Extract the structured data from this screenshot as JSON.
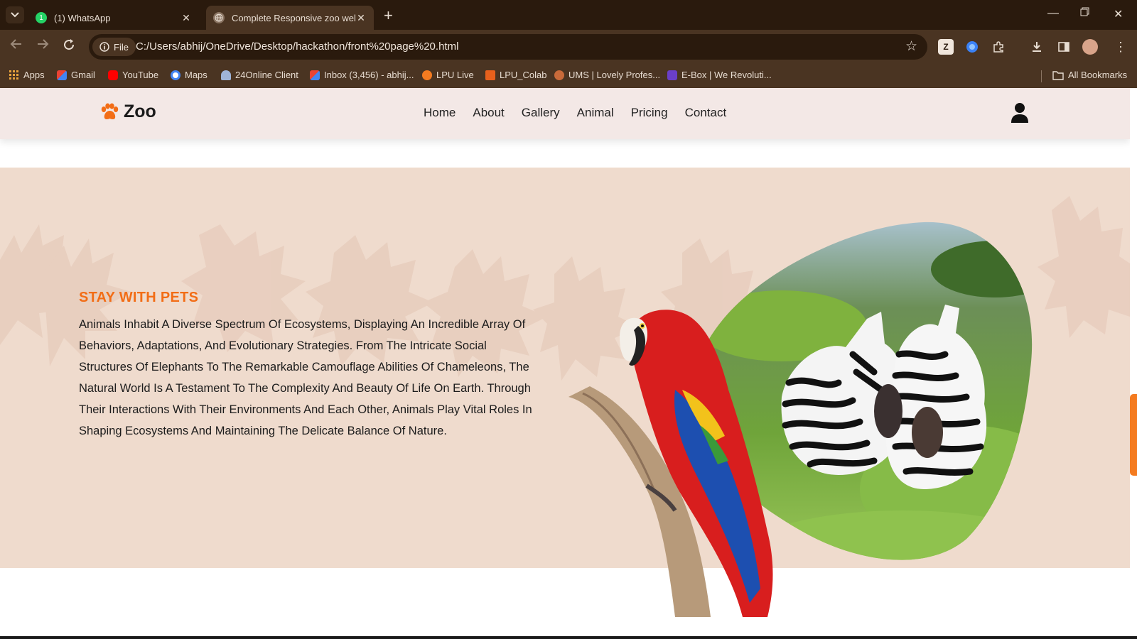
{
  "browser": {
    "tabs": [
      {
        "title": "(1) WhatsApp",
        "favicon": "whatsapp-icon",
        "active": false
      },
      {
        "title": "Complete Responsive zoo website",
        "favicon": "globe-icon",
        "active": true
      }
    ],
    "address": {
      "chip_label": "File",
      "url": "C:/Users/abhij/OneDrive/Desktop/hackathon/front%20page%20.html"
    },
    "bookmarks": [
      {
        "label": "Apps",
        "icon": "apps-grid-icon"
      },
      {
        "label": "Gmail",
        "icon": "gmail-icon"
      },
      {
        "label": "YouTube",
        "icon": "youtube-icon"
      },
      {
        "label": "Maps",
        "icon": "google-icon"
      },
      {
        "label": "24Online Client",
        "icon": "cloud-icon"
      },
      {
        "label": "Inbox (3,456) - abhij...",
        "icon": "gmail-icon"
      },
      {
        "label": "LPU Live",
        "icon": "lpu-live-icon"
      },
      {
        "label": "LPU_Colab",
        "icon": "lpu-colab-icon"
      },
      {
        "label": "UMS | Lovely Profes...",
        "icon": "ums-icon"
      },
      {
        "label": "E-Box | We Revoluti...",
        "icon": "ebox-icon"
      }
    ],
    "all_bookmarks": "All Bookmarks"
  },
  "site": {
    "logo": "Zoo",
    "nav": [
      "Home",
      "About",
      "Gallery",
      "Animal",
      "Pricing",
      "Contact"
    ]
  },
  "about": {
    "kicker": "STAY WITH PETS",
    "paragraph": "Animals Inhabit A Diverse Spectrum Of Ecosystems, Displaying An Incredible Array Of Behaviors, Adaptations, And Evolutionary Strategies. From The Intricate Social Structures Of Elephants To The Remarkable Camouflage Abilities Of Chameleons, The Natural World Is A Testament To The Complexity And Beauty Of Life On Earth. Through Their Interactions With Their Environments And Each Other, Animals Play Vital Roles In Shaping Ecosystems And Maintaining The Delicate Balance Of Nature."
  },
  "colors": {
    "accent": "#f26d16",
    "header_bg": "#f3e8e6",
    "section_bg": "#efdbcd",
    "chrome_dark": "#2a1a0d",
    "chrome_mid": "#4a3422"
  }
}
